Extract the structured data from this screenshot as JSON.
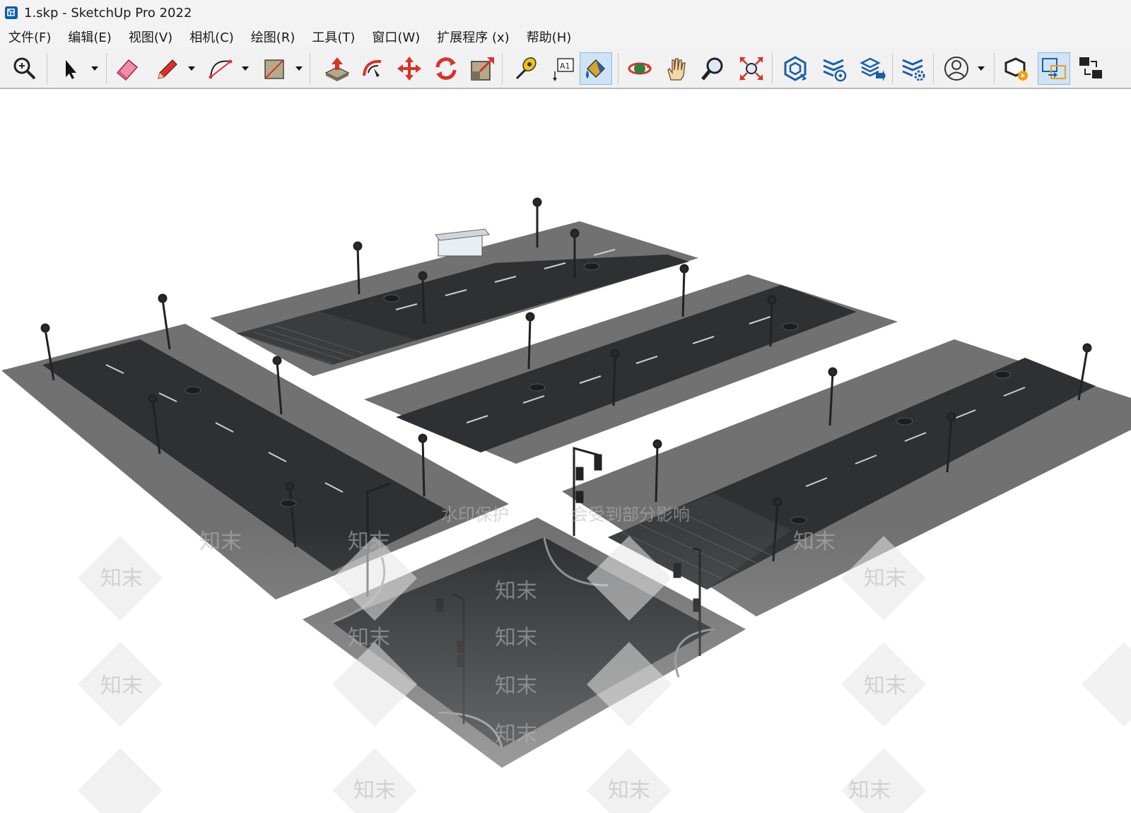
{
  "window": {
    "title": "1.skp - SketchUp Pro 2022"
  },
  "menu": [
    {
      "label": "文件(F)"
    },
    {
      "label": "编辑(E)"
    },
    {
      "label": "视图(V)"
    },
    {
      "label": "相机(C)"
    },
    {
      "label": "绘图(R)"
    },
    {
      "label": "工具(T)"
    },
    {
      "label": "窗口(W)"
    },
    {
      "label": "扩展程序 (x)"
    },
    {
      "label": "帮助(H)"
    }
  ],
  "toolbar": {
    "tools": [
      {
        "name": "zoom-extents-icon"
      },
      {
        "name": "select-icon"
      },
      {
        "name": "eraser-icon"
      },
      {
        "name": "pencil-icon"
      },
      {
        "name": "arc-icon"
      },
      {
        "name": "rectangle-icon"
      },
      {
        "name": "push-pull-icon"
      },
      {
        "name": "follow-me-icon"
      },
      {
        "name": "move-icon"
      },
      {
        "name": "rotate-icon"
      },
      {
        "name": "scale-icon"
      },
      {
        "name": "tape-measure-icon"
      },
      {
        "name": "text-icon"
      },
      {
        "name": "paint-bucket-icon"
      },
      {
        "name": "orbit-icon"
      },
      {
        "name": "pan-icon"
      },
      {
        "name": "zoom-icon"
      },
      {
        "name": "zoom-window-icon"
      },
      {
        "name": "warehouse-icon"
      },
      {
        "name": "extension-manager-icon"
      },
      {
        "name": "layout-send-icon"
      },
      {
        "name": "extension-settings-icon"
      },
      {
        "name": "account-icon"
      },
      {
        "name": "live-components-icon"
      },
      {
        "name": "transfer-icon"
      },
      {
        "name": "scenes-icon"
      }
    ],
    "active_tool": "paint-bucket-icon"
  },
  "viewport": {
    "watermark_text": [
      "知末",
      "水印保护",
      "会受到部分影响"
    ],
    "colors": {
      "asphalt": "#2e2f31",
      "sidewalk": "#6e6e6e",
      "lane_marking": "#d9d9d9"
    }
  }
}
